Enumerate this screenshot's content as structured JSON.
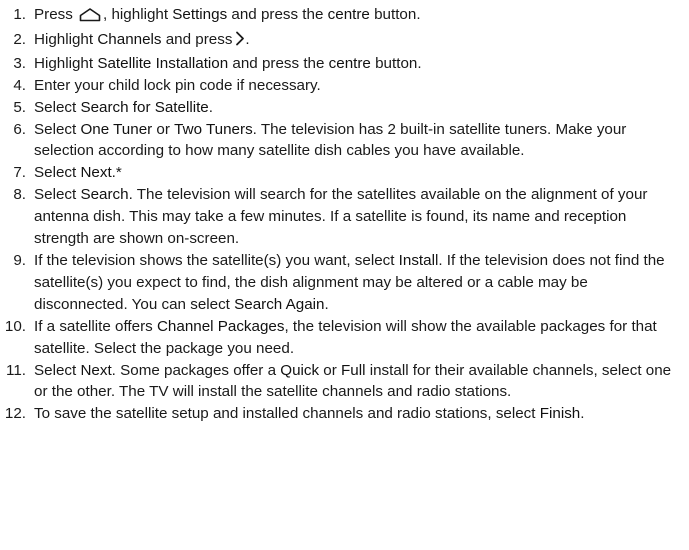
{
  "steps": [
    {
      "n": "1.",
      "parts": [
        {
          "t": "Press ",
          "e": false
        },
        {
          "icon": "home-icon"
        },
        {
          "t": ", highlight ",
          "e": false
        },
        {
          "t": "Settings",
          "e": true
        },
        {
          "t": " and press the ",
          "e": false
        },
        {
          "t": "centre",
          "e": true
        },
        {
          "t": " button.",
          "e": false
        }
      ]
    },
    {
      "n": "2.",
      "parts": [
        {
          "t": "Highlight ",
          "e": false
        },
        {
          "t": "Channels",
          "e": true
        },
        {
          "t": " and press",
          "e": false
        },
        {
          "icon": "chevron-right-icon"
        },
        {
          "t": ".",
          "e": false
        }
      ]
    },
    {
      "n": "3.",
      "parts": [
        {
          "t": "Highlight ",
          "e": false
        },
        {
          "t": "Satellite Installation",
          "e": true
        },
        {
          "t": " and press the ",
          "e": false
        },
        {
          "t": "centre",
          "e": true
        },
        {
          "t": " button.",
          "e": false
        }
      ]
    },
    {
      "n": "4.",
      "parts": [
        {
          "t": "Enter your child lock pin code if necessary.",
          "e": false
        }
      ]
    },
    {
      "n": "5.",
      "parts": [
        {
          "t": "Select ",
          "e": false
        },
        {
          "t": "Search for Satellite",
          "e": true
        },
        {
          "t": ".",
          "e": false
        }
      ]
    },
    {
      "n": "6.",
      "parts": [
        {
          "t": "Select ",
          "e": false
        },
        {
          "t": "One Tuner",
          "e": true
        },
        {
          "t": " or ",
          "e": false
        },
        {
          "t": "Two Tuners",
          "e": true
        },
        {
          "t": ". The television has 2 built-in satellite tuners. Make your selection according to how many satellite dish cables you have available.",
          "e": false
        }
      ]
    },
    {
      "n": "7.",
      "parts": [
        {
          "t": "Select ",
          "e": false
        },
        {
          "t": "Next",
          "e": true
        },
        {
          "t": ".*",
          "e": false
        }
      ]
    },
    {
      "n": "8.",
      "parts": [
        {
          "t": "Select ",
          "e": false
        },
        {
          "t": "Search",
          "e": true
        },
        {
          "t": ". The television will search for the satellites available on the alignment of your antenna dish. This may take a few minutes. If a satellite is found, its name and reception strength are shown on-screen.",
          "e": false
        }
      ]
    },
    {
      "n": "9.",
      "parts": [
        {
          "t": "If the television shows the satellite(s) you want, select ",
          "e": false
        },
        {
          "t": "Instal",
          "e": true
        },
        {
          "t": "l. If the television does not find the satellite(s) you expect to find, the dish alignment may be altered or a cable may be disconnected. You can select ",
          "e": false
        },
        {
          "t": "Search Again",
          "e": true
        },
        {
          "t": ".",
          "e": false
        }
      ]
    },
    {
      "n": "10.",
      "parts": [
        {
          "t": "If a satellite offers ",
          "e": false
        },
        {
          "t": "Channel Packages",
          "e": true
        },
        {
          "t": ", the television will show the available packages for that satellite. Select the package you need.",
          "e": false
        }
      ]
    },
    {
      "n": "11.",
      "parts": [
        {
          "t": "Select ",
          "e": false
        },
        {
          "t": "Next",
          "e": true
        },
        {
          "t": ". Some packages offer a ",
          "e": false
        },
        {
          "t": "Quick",
          "e": true
        },
        {
          "t": " or ",
          "e": false
        },
        {
          "t": "Full",
          "e": true
        },
        {
          "t": " install for their available channels, select one or the other. The TV will install the satellite channels and radio stations.",
          "e": false
        }
      ]
    },
    {
      "n": "12.",
      "parts": [
        {
          "t": "To save the satellite setup and installed channels and radio stations, select ",
          "e": false
        },
        {
          "t": "Finish",
          "e": true
        },
        {
          "t": ".",
          "e": false
        }
      ]
    }
  ]
}
